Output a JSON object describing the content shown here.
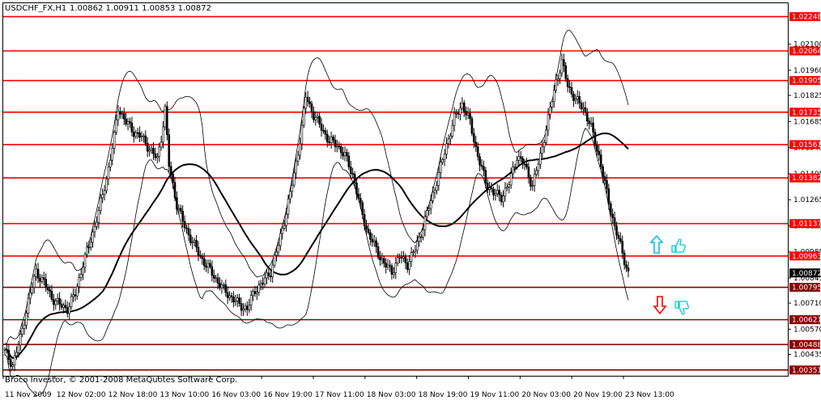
{
  "header": {
    "symbol": "USDCHF_FX,H1",
    "ohlc": "1.00862 1.00911 1.00853 1.00872"
  },
  "copyright": "Broco Investor, © 2001-2008 MetaQuotes Software Corp.",
  "colors": {
    "background": "#ffffff",
    "candle": "#000000",
    "level_line": "#ff0000",
    "level_line_dark": "#8b0000",
    "level_label_bg": "#ff0000",
    "level_label_bg_dark": "#8b0000",
    "current_label_bg": "#000000",
    "arrow_up": "#00bfff",
    "arrow_down": "#ff0000",
    "hand_icon": "#00ced1"
  },
  "chart_data": {
    "type": "candlestick",
    "ylim": [
      1.0032,
      1.0232
    ],
    "y_ticks": [
      "1.02100",
      "1.01960",
      "1.01825",
      "1.01685",
      "1.01545",
      "1.01405",
      "1.01265",
      "1.01125",
      "1.00985",
      "1.00845",
      "1.00710",
      "1.00570",
      "1.00435",
      "1.00295"
    ],
    "x_labels": [
      "11 Nov 2009",
      "12 Nov 02:00",
      "12 Nov 18:00",
      "13 Nov 10:00",
      "16 Nov 03:00",
      "16 Nov 19:00",
      "17 Nov 11:00",
      "18 Nov 03:00",
      "18 Nov 19:00",
      "19 Nov 11:00",
      "20 Nov 03:00",
      "20 Nov 19:00",
      "23 Nov 13:00"
    ],
    "levels": [
      {
        "label": "1.02248",
        "value": 1.02248,
        "tone": "red"
      },
      {
        "label": "1.02064",
        "value": 1.02064,
        "tone": "red"
      },
      {
        "label": "1.01905",
        "value": 1.01905,
        "tone": "red"
      },
      {
        "label": "1.01735",
        "value": 1.01735,
        "tone": "red"
      },
      {
        "label": "1.01561",
        "value": 1.01561,
        "tone": "red"
      },
      {
        "label": "1.01382",
        "value": 1.01382,
        "tone": "red"
      },
      {
        "label": "1.01137",
        "value": 1.01137,
        "tone": "red"
      },
      {
        "label": "1.00963",
        "value": 1.00963,
        "tone": "red"
      },
      {
        "label": "1.00795",
        "value": 1.00795,
        "tone": "dark"
      },
      {
        "label": "1.00621",
        "value": 1.00621,
        "tone": "dark"
      },
      {
        "label": "1.00488",
        "value": 1.00488,
        "tone": "dark"
      },
      {
        "label": "1.00351",
        "value": 1.00351,
        "tone": "dark"
      }
    ],
    "current_price": {
      "label": "1.00872",
      "value": 1.00872
    },
    "close_path": [
      [
        0,
        1.0045
      ],
      [
        4,
        1.0038
      ],
      [
        8,
        1.0052
      ],
      [
        12,
        1.0072
      ],
      [
        16,
        1.0088
      ],
      [
        20,
        1.0082
      ],
      [
        24,
        1.0074
      ],
      [
        28,
        1.007
      ],
      [
        32,
        1.0068
      ],
      [
        36,
        1.0076
      ],
      [
        40,
        1.0092
      ],
      [
        44,
        1.0105
      ],
      [
        48,
        1.012
      ],
      [
        52,
        1.0138
      ],
      [
        56,
        1.016
      ],
      [
        58,
        1.0176
      ],
      [
        62,
        1.0168
      ],
      [
        66,
        1.0163
      ],
      [
        70,
        1.016
      ],
      [
        74,
        1.0154
      ],
      [
        78,
        1.0148
      ],
      [
        80,
        1.016
      ],
      [
        82,
        1.0175
      ],
      [
        84,
        1.0145
      ],
      [
        88,
        1.0124
      ],
      [
        92,
        1.0112
      ],
      [
        96,
        1.0104
      ],
      [
        100,
        1.0096
      ],
      [
        104,
        1.009
      ],
      [
        108,
        1.0084
      ],
      [
        112,
        1.0078
      ],
      [
        116,
        1.0074
      ],
      [
        120,
        1.007
      ],
      [
        124,
        1.0068
      ],
      [
        128,
        1.0078
      ],
      [
        132,
        1.0082
      ],
      [
        136,
        1.0088
      ],
      [
        140,
        1.0102
      ],
      [
        144,
        1.012
      ],
      [
        148,
        1.014
      ],
      [
        152,
        1.0165
      ],
      [
        154,
        1.0182
      ],
      [
        158,
        1.0172
      ],
      [
        162,
        1.0165
      ],
      [
        166,
        1.0158
      ],
      [
        170,
        1.0156
      ],
      [
        174,
        1.015
      ],
      [
        178,
        1.014
      ],
      [
        182,
        1.0122
      ],
      [
        186,
        1.0108
      ],
      [
        190,
        1.01
      ],
      [
        194,
        1.0092
      ],
      [
        198,
        1.0088
      ],
      [
        202,
        1.0096
      ],
      [
        206,
        1.0092
      ],
      [
        210,
        1.01
      ],
      [
        214,
        1.0112
      ],
      [
        218,
        1.0126
      ],
      [
        222,
        1.014
      ],
      [
        226,
        1.0156
      ],
      [
        230,
        1.017
      ],
      [
        234,
        1.0178
      ],
      [
        238,
        1.0168
      ],
      [
        242,
        1.015
      ],
      [
        246,
        1.0136
      ],
      [
        250,
        1.013
      ],
      [
        254,
        1.0128
      ],
      [
        258,
        1.0135
      ],
      [
        262,
        1.015
      ],
      [
        266,
        1.0145
      ],
      [
        270,
        1.0134
      ],
      [
        274,
        1.015
      ],
      [
        278,
        1.017
      ],
      [
        282,
        1.019
      ],
      [
        285,
        1.02
      ],
      [
        288,
        1.0188
      ],
      [
        292,
        1.018
      ],
      [
        296,
        1.0176
      ],
      [
        300,
        1.0165
      ],
      [
        304,
        1.015
      ],
      [
        308,
        1.013
      ],
      [
        312,
        1.0112
      ],
      [
        316,
        1.0098
      ],
      [
        319,
        1.0087
      ]
    ],
    "indicators": [
      "moving-average",
      "bollinger-upper",
      "bollinger-lower"
    ]
  }
}
